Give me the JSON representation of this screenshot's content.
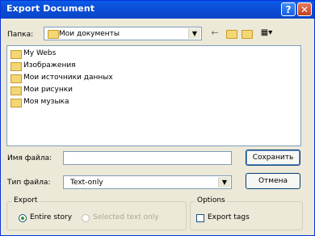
{
  "window": {
    "title": "Export Document",
    "help_glyph": "?",
    "close_glyph": "✕"
  },
  "lookin": {
    "label": "Папка:",
    "value": "Мои документы"
  },
  "toolbar": {
    "icons": [
      "back-arrow-icon",
      "up-folder-icon",
      "new-folder-icon",
      "view-menu-icon"
    ]
  },
  "files": [
    {
      "name": "My Webs",
      "icon": "folder-icon"
    },
    {
      "name": "Изображения",
      "icon": "folder-icon"
    },
    {
      "name": "Мои источники данных",
      "icon": "folder-icon"
    },
    {
      "name": "Мои рисунки",
      "icon": "folder-icon"
    },
    {
      "name": "Моя музыка",
      "icon": "folder-icon"
    }
  ],
  "filename": {
    "label": "Имя файла:",
    "value": ""
  },
  "filetype": {
    "label": "Тип файла:",
    "value": "Text-only"
  },
  "buttons": {
    "save": "Сохранить",
    "cancel": "Отмена"
  },
  "export": {
    "legend": "Export",
    "entire": "Entire story",
    "selected": "Selected text only"
  },
  "options": {
    "legend": "Options",
    "tags": "Export tags"
  }
}
